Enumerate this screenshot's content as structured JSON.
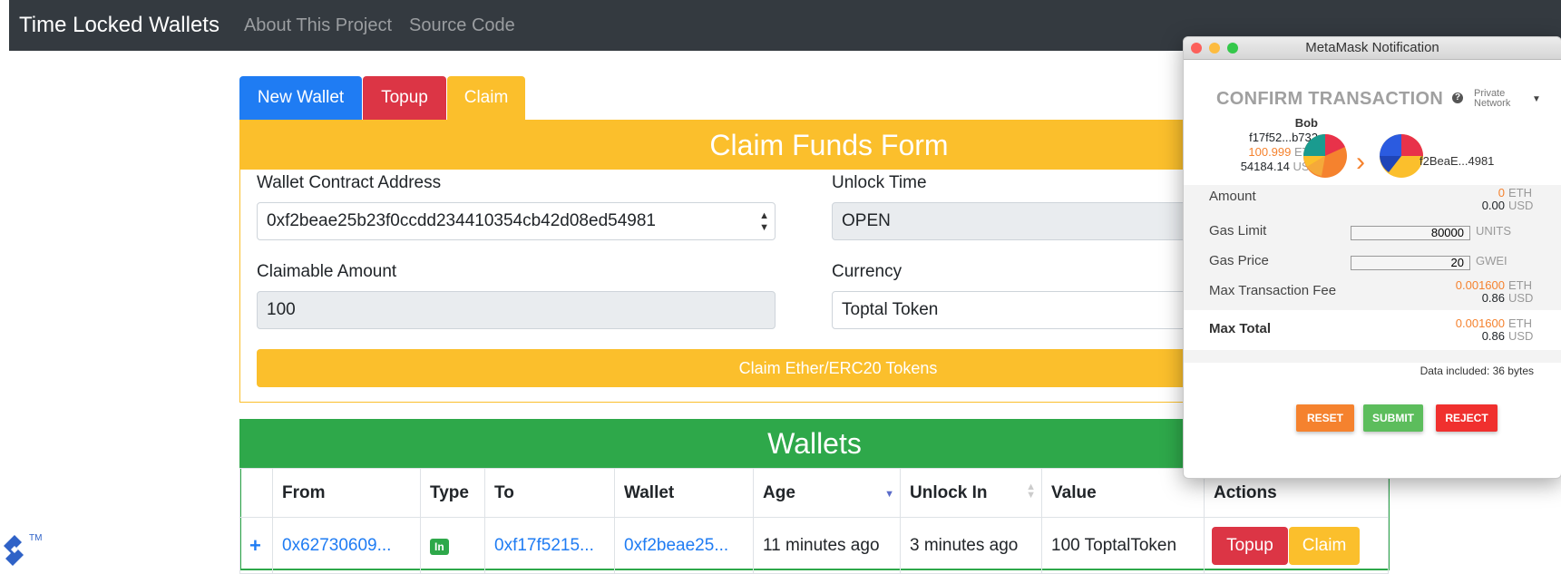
{
  "navbar": {
    "brand": "Time Locked Wallets",
    "links": [
      "About This Project",
      "Source Code"
    ]
  },
  "tabs": [
    "New Wallet",
    "Topup",
    "Claim"
  ],
  "claim_form": {
    "title": "Claim Funds Form",
    "wallet_address_label": "Wallet Contract Address",
    "wallet_address_value": "0xf2beae25b23f0ccdd234410354cb42d08ed54981",
    "unlock_time_label": "Unlock Time",
    "unlock_time_value": "OPEN",
    "claimable_amount_label": "Claimable Amount",
    "claimable_amount_value": "100",
    "currency_label": "Currency",
    "currency_value": "Toptal Token",
    "submit_label": "Claim Ether/ERC20 Tokens"
  },
  "wallets": {
    "title": "Wallets",
    "columns": [
      "",
      "From",
      "Type",
      "To",
      "Wallet",
      "Age",
      "Unlock In",
      "Value",
      "Actions"
    ],
    "rows": [
      {
        "expand": "+",
        "from": "0x62730609...",
        "type": "In",
        "to": "0xf17f5215...",
        "wallet": "0xf2beae25...",
        "age": "11 minutes ago",
        "unlock_in": "3 minutes ago",
        "value": "100 ToptalToken",
        "actions": [
          "Topup",
          "Claim"
        ]
      }
    ]
  },
  "metamask": {
    "window_title": "MetaMask Notification",
    "heading": "CONFIRM TRANSACTION",
    "network_line1": "Private",
    "network_line2": "Network",
    "from_name": "Bob",
    "from_address": "f17f52...b732",
    "from_eth": "100.999",
    "from_eth_unit": "ETH",
    "from_usd": "54184.14",
    "from_usd_unit": "USD",
    "to_address": "f2BeaE...4981",
    "amount_label": "Amount",
    "amount_eth": "0",
    "amount_usd": "0.00",
    "gas_limit_label": "Gas Limit",
    "gas_limit_value": "80000",
    "gas_limit_unit": "UNITS",
    "gas_price_label": "Gas Price",
    "gas_price_value": "20",
    "gas_price_unit": "GWEI",
    "max_fee_label": "Max Transaction Fee",
    "max_fee_eth": "0.001600",
    "max_fee_usd": "0.86",
    "max_total_label": "Max Total",
    "max_total_eth": "0.001600",
    "max_total_usd": "0.86",
    "eth_unit": "ETH",
    "usd_unit": "USD",
    "data_included": "Data included: 36 bytes",
    "reset_label": "RESET",
    "submit_label": "SUBMIT",
    "reject_label": "REJECT"
  },
  "colors": {
    "navbar": "#343a40",
    "primary": "#1f7cf3",
    "danger": "#dc3545",
    "warning": "#fbbf2c",
    "success": "#2ea84a",
    "metamask_orange": "#f5822e"
  },
  "icons": {
    "select_arrow": "select-caret-icon",
    "sort": "sort-icon",
    "logo": "toptal-logo"
  }
}
